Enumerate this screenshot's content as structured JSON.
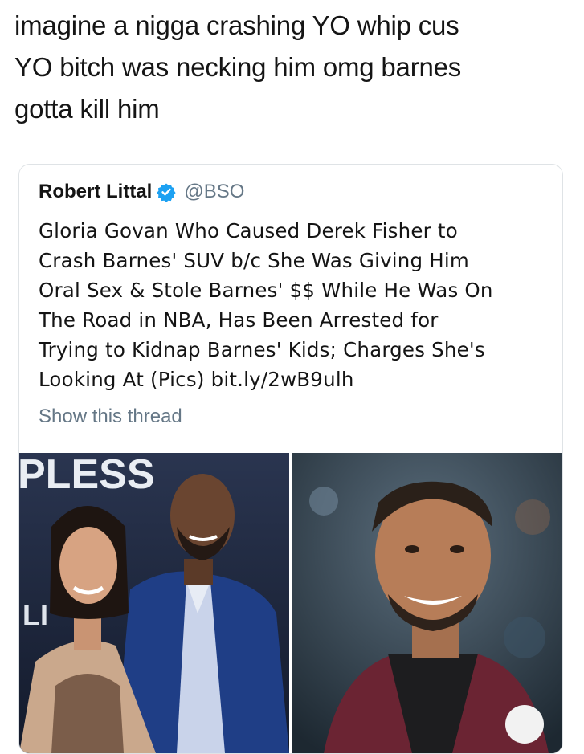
{
  "caption": {
    "line1": "imagine a nigga crashing YO whip cus",
    "line2": "YO bitch was necking him omg barnes",
    "line3": "gotta kill him"
  },
  "tweet": {
    "author_name": "Robert Littal",
    "verified_icon": "verified-badge-icon",
    "handle": "@BSO",
    "text_lines": [
      "Gloria Govan Who Caused Derek Fisher to",
      "Crash Barnes' SUV b/c She Was Giving Him",
      "Oral Sex & Stole Barnes' $$ While He Was On",
      "The Road in NBA, Has Been Arrested for",
      "Trying to Kidnap Barnes' Kids; Charges She's",
      "Looking At (Pics) bit.ly/2wB9ulh"
    ],
    "show_thread": "Show this thread",
    "backdrop_text": "PLESS",
    "backdrop_text_2": "LI"
  },
  "colors": {
    "accent": "#1da1f2",
    "muted": "#657786"
  }
}
